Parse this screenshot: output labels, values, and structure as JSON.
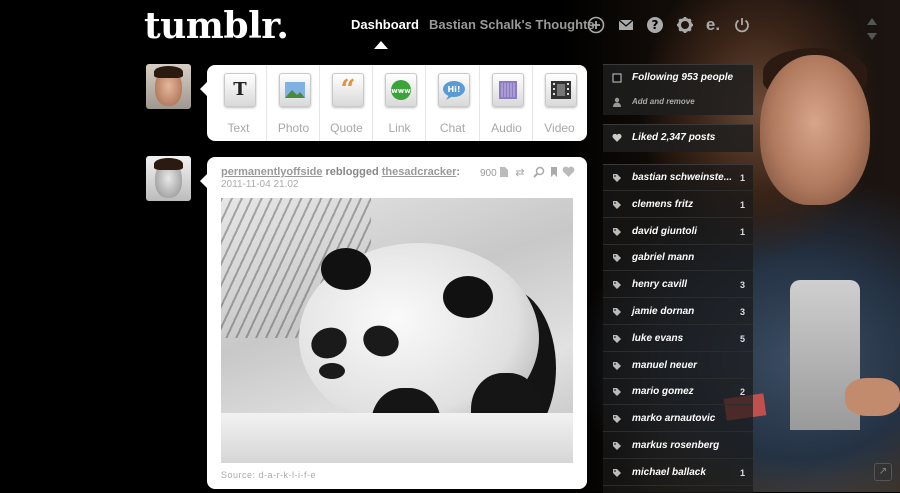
{
  "header": {
    "logo": "tumblr.",
    "nav": {
      "dashboard": "Dashboard",
      "blog": "Bastian Schalk's Thoughts"
    },
    "icons": [
      "plus-icon",
      "mail-icon",
      "help-icon",
      "gear-icon",
      "edit-icon",
      "power-icon"
    ]
  },
  "post_types": [
    {
      "label": "Text",
      "icon": "T",
      "color": "#333333"
    },
    {
      "label": "Photo",
      "icon": "photo-icon",
      "color": "#6fa8dc"
    },
    {
      "label": "Quote",
      "icon": "“",
      "color": "#e69138"
    },
    {
      "label": "Link",
      "icon": "www",
      "color": "#38a838"
    },
    {
      "label": "Chat",
      "icon": "Hi!",
      "color": "#5b9bd5"
    },
    {
      "label": "Audio",
      "icon": "audio-icon",
      "color": "#8e7cc3"
    },
    {
      "label": "Video",
      "icon": "video-icon",
      "color": "#444444"
    }
  ],
  "post": {
    "author": "permanentlyoffside",
    "action": "reblogged",
    "source_blog": "thesadcracker",
    "date": "2011-11-04 21.02",
    "notes_count": "900",
    "source": "Source: d-a-r-k-l-i-f-e"
  },
  "sidebar": {
    "following": "Following 953 people",
    "add_remove": "Add and remove",
    "liked": "Liked 2,347 posts",
    "tags": [
      {
        "name": "bastian schweinste...",
        "count": "1"
      },
      {
        "name": "clemens fritz",
        "count": "1"
      },
      {
        "name": "david giuntoli",
        "count": "1"
      },
      {
        "name": "gabriel mann",
        "count": ""
      },
      {
        "name": "henry cavill",
        "count": "3"
      },
      {
        "name": "jamie dornan",
        "count": "3"
      },
      {
        "name": "luke evans",
        "count": "5"
      },
      {
        "name": "manuel neuer",
        "count": ""
      },
      {
        "name": "mario gomez",
        "count": "2"
      },
      {
        "name": "marko arnautovic",
        "count": ""
      },
      {
        "name": "markus rosenberg",
        "count": ""
      },
      {
        "name": "michael ballack",
        "count": "1"
      }
    ]
  }
}
